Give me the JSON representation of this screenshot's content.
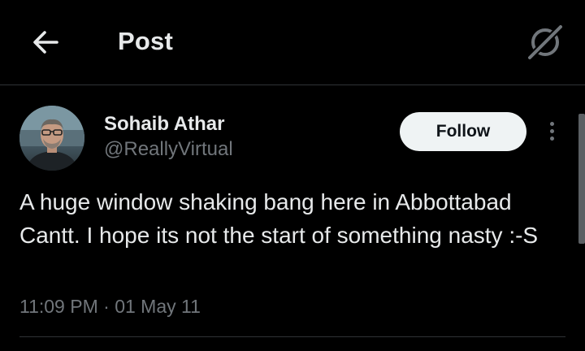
{
  "header": {
    "back_icon": "arrow-left-icon",
    "title": "Post",
    "grok_icon": "grok-slash-icon"
  },
  "post": {
    "author": {
      "name": "Sohaib Athar",
      "handle": "@ReallyVirtual"
    },
    "follow_label": "Follow",
    "more_icon": "more-vertical-icon",
    "text": "A huge window shaking bang here in Abbottabad Cantt. I hope its not the start of something nasty :-S",
    "time": "11:09 PM",
    "separator": "·",
    "date": "01 May 11"
  },
  "colors": {
    "background": "#000000",
    "primary_text": "#e7e9ea",
    "secondary_text": "#71767b",
    "follow_bg": "#eff3f4",
    "divider": "#2f3336"
  }
}
